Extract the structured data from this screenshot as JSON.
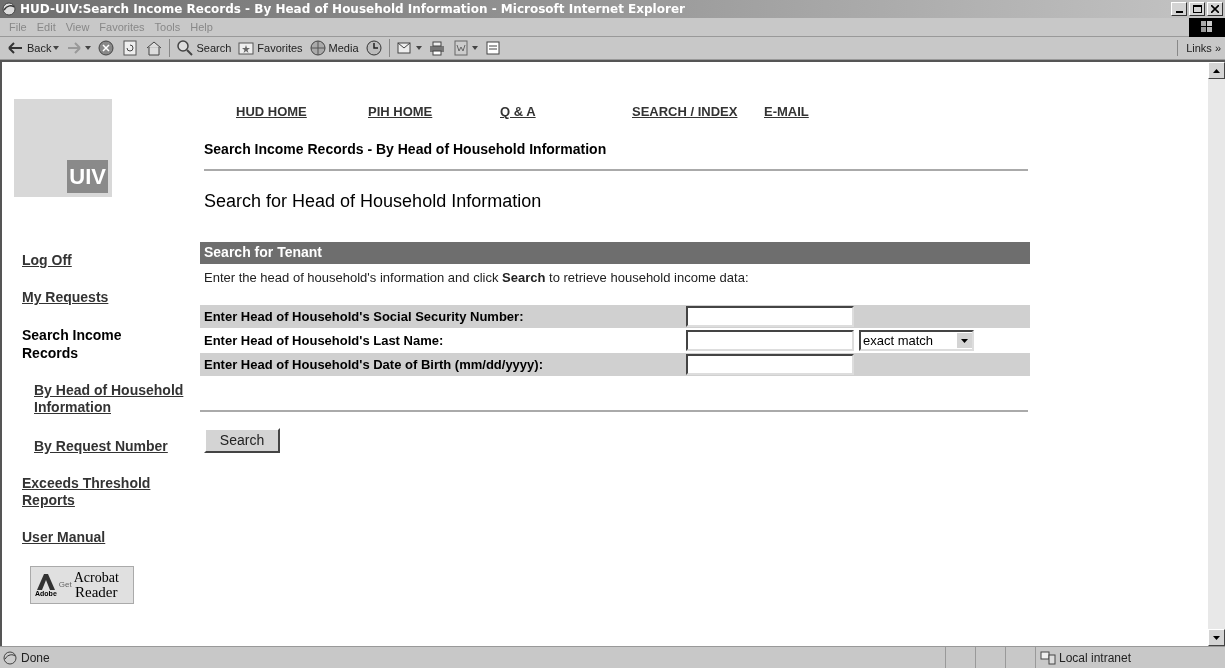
{
  "window": {
    "title": "HUD-UIV:Search Income Records - By Head of Household Information - Microsoft Internet Explorer"
  },
  "menu": [
    "File",
    "Edit",
    "View",
    "Favorites",
    "Tools",
    "Help"
  ],
  "toolbar": [
    {
      "kind": "back",
      "label": "Back"
    },
    {
      "kind": "forward"
    },
    {
      "kind": "stop"
    },
    {
      "kind": "refresh"
    },
    {
      "kind": "home"
    },
    {
      "kind": "search",
      "label": "Search"
    },
    {
      "kind": "favorites",
      "label": "Favorites"
    },
    {
      "kind": "media",
      "label": "Media"
    },
    {
      "kind": "history"
    },
    {
      "kind": "mail"
    },
    {
      "kind": "print"
    },
    {
      "kind": "edit"
    },
    {
      "kind": "discuss"
    }
  ],
  "links_label": "Links »",
  "logo": {
    "text": "UIV"
  },
  "nav": [
    "HUD HOME",
    "PIH HOME",
    "Q & A",
    "SEARCH / INDEX",
    "E-MAIL"
  ],
  "breadcrumb": "Search Income Records - By Head of Household Information",
  "heading": "Search for Head of Household Information",
  "sidebar": {
    "items": [
      {
        "label": "Log Off",
        "selected": false
      },
      {
        "label": "My Requests",
        "selected": false
      },
      {
        "label": "Search Income Records",
        "selected": true,
        "children": [
          {
            "label": "By Head of Household Information",
            "selected": false
          },
          {
            "label": "By Request Number",
            "selected": false
          }
        ]
      },
      {
        "label": "Exceeds Threshold Reports",
        "selected": false
      },
      {
        "label": "User Manual",
        "selected": false
      }
    ],
    "acrobat_badge": {
      "brand": "Adobe",
      "get": "Get",
      "line1": "Acrobat",
      "line2": "Reader"
    }
  },
  "form": {
    "section_title": "Search for Tenant",
    "intro": "Enter the head of household's information and click **Search** to retrieve household income data:",
    "rows": [
      {
        "label": "Enter Head of Household's Social Security Number:"
      },
      {
        "label": "Enter Head of Household's Last Name:",
        "match_select": "exact match"
      },
      {
        "label": "Enter Head of Household's Date of Birth (mm/dd/yyyy):"
      }
    ],
    "submit": "Search"
  },
  "status_bar": {
    "text": "Done",
    "zone": "Local intranet"
  }
}
